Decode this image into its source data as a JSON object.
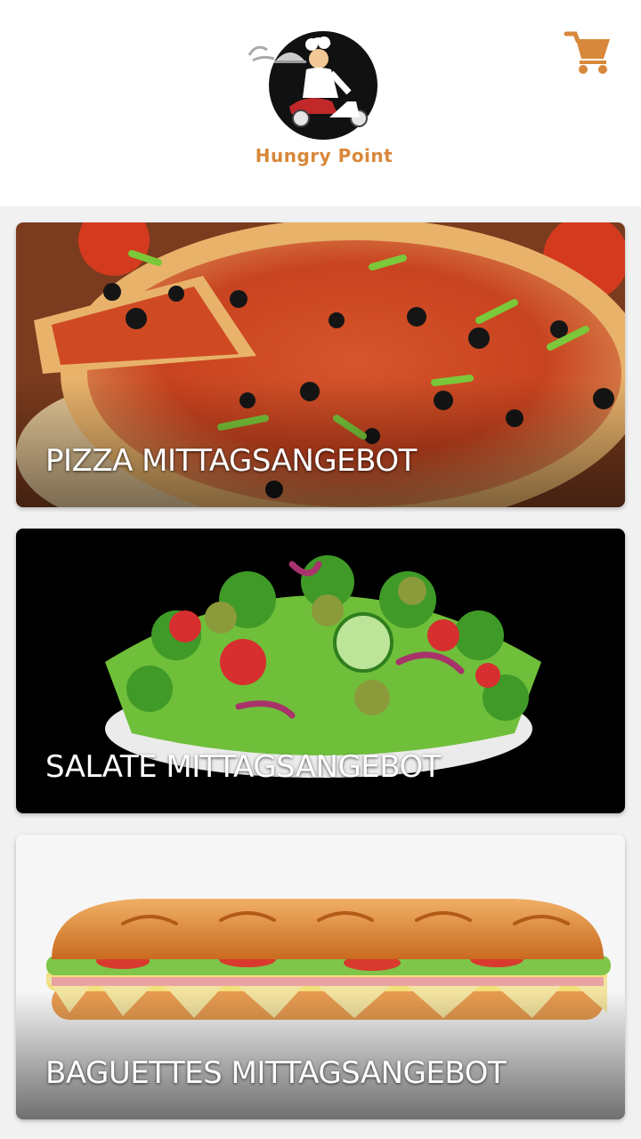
{
  "header": {
    "brand_name": "Hungry Point",
    "brand_color": "#d8883a",
    "cart_icon": "shopping-cart-icon"
  },
  "categories": [
    {
      "title": "PIZZA MITTAGSANGEBOT",
      "image": "pizza"
    },
    {
      "title": "SALATE MITTAGSANGEBOT",
      "image": "salad-bowl"
    },
    {
      "title": "BAGUETTES MITTAGSANGEBOT",
      "image": "baguette-sandwich"
    }
  ]
}
